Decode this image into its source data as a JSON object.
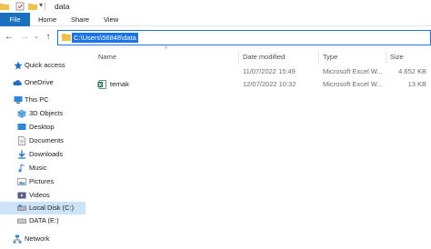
{
  "window": {
    "title": "data"
  },
  "ribbon": {
    "tabs": [
      "File",
      "Home",
      "Share",
      "View"
    ]
  },
  "address": {
    "path": "C:\\Users\\56848\\data"
  },
  "sidebar": {
    "items": [
      {
        "label": "Quick access",
        "icon": "star-icon"
      },
      {
        "label": "OneDrive",
        "icon": "cloud-icon"
      },
      {
        "label": "This PC",
        "icon": "computer-icon"
      },
      {
        "label": "3D Objects",
        "icon": "cube-icon"
      },
      {
        "label": "Desktop",
        "icon": "desktop-icon"
      },
      {
        "label": "Documents",
        "icon": "documents-icon"
      },
      {
        "label": "Downloads",
        "icon": "download-icon"
      },
      {
        "label": "Music",
        "icon": "music-icon"
      },
      {
        "label": "Pictures",
        "icon": "pictures-icon"
      },
      {
        "label": "Videos",
        "icon": "videos-icon"
      },
      {
        "label": "Local Disk (C:)",
        "icon": "drive-icon",
        "selected": true
      },
      {
        "label": "DATA (E:)",
        "icon": "drive-icon"
      },
      {
        "label": "Network",
        "icon": "network-icon"
      }
    ]
  },
  "columns": {
    "name": "Name",
    "date": "Date modified",
    "type": "Type",
    "size": "Size"
  },
  "files": [
    {
      "name": "",
      "date": "11/07/2022 15:49",
      "type": "Microsoft Excel W...",
      "size": "4.652 KB"
    },
    {
      "name": "ternak",
      "date": "12/07/2022 10:32",
      "type": "Microsoft Excel W...",
      "size": "13 KB"
    }
  ],
  "colors": {
    "accent": "#1a73e8",
    "file_tab": "#1a6fc0",
    "selection": "#cce4f7",
    "folder": "#f0c24a",
    "excel": "#1e7145"
  }
}
